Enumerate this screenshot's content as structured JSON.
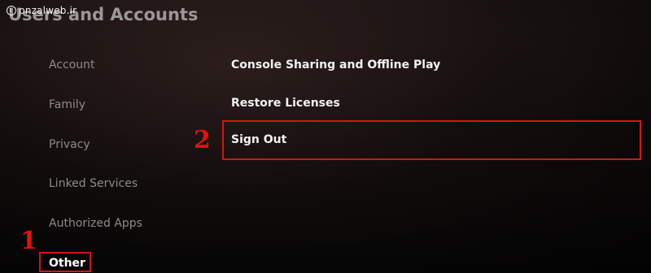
{
  "watermark": {
    "text": "pnzalweb.ir",
    "icon": "info-circle-icon"
  },
  "page": {
    "title": "Users and Accounts"
  },
  "sidebar": {
    "items": [
      {
        "label": "Account"
      },
      {
        "label": "Family"
      },
      {
        "label": "Privacy"
      },
      {
        "label": "Linked Services"
      },
      {
        "label": "Authorized Apps"
      },
      {
        "label": "Other",
        "selected": true
      }
    ]
  },
  "menu": {
    "items": [
      {
        "label": "Console Sharing and Offline Play"
      },
      {
        "label": "Restore Licenses"
      },
      {
        "label": "Sign Out"
      }
    ]
  },
  "annotations": {
    "step1": "1",
    "step2": "2",
    "highlight_color": "#d11616"
  },
  "colors": {
    "background": "#0b0909",
    "text_primary": "#f3f1f1",
    "text_secondary": "#8f8a8a"
  }
}
